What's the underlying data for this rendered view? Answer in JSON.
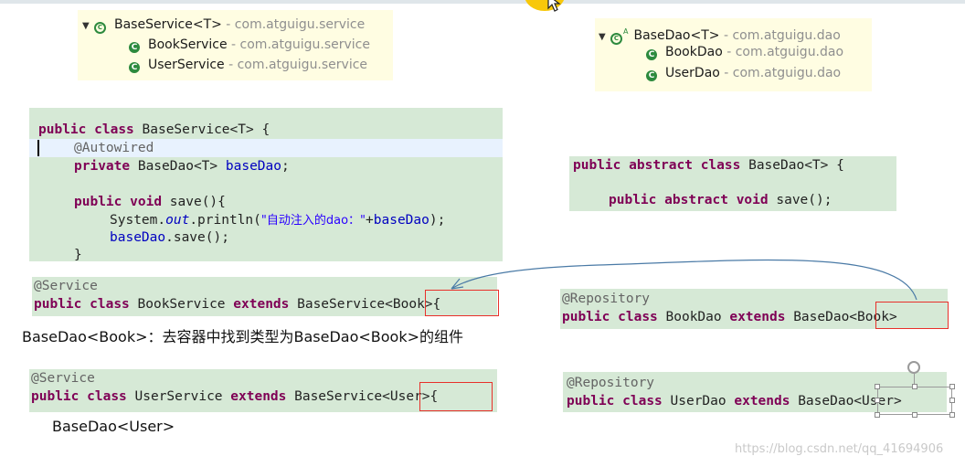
{
  "tree_service": {
    "root": {
      "name": "BaseService<T>",
      "pkg": " - com.atguigu.service"
    },
    "children": [
      {
        "name": "BookService",
        "pkg": " - com.atguigu.service"
      },
      {
        "name": "UserService",
        "pkg": " - com.atguigu.service"
      }
    ]
  },
  "tree_dao": {
    "root": {
      "name": "BaseDao<T>",
      "pkg": " - com.atguigu.dao"
    },
    "children": [
      {
        "name": "BookDao",
        "pkg": " - com.atguigu.dao"
      },
      {
        "name": "UserDao",
        "pkg": " - com.atguigu.dao"
      }
    ]
  },
  "base_service_code": {
    "l1": {
      "kw1": "public",
      "kw2": "class",
      "rest": " BaseService<T> {"
    },
    "l2": {
      "ann": "@Autowired"
    },
    "l3": {
      "kw": "private",
      "type": " BaseDao<T> ",
      "field": "baseDao",
      "end": ";"
    },
    "l4": {
      "kw1": "public",
      "kw2": "void",
      "rest": " save(){"
    },
    "l5": {
      "pre": "System.",
      "out": "out",
      "mid": ".println(",
      "str": "\"自动注入的dao：\"",
      "plus": "+",
      "field": "baseDao",
      "end": ");"
    },
    "l6": {
      "field": "baseDao",
      "rest": ".save();"
    },
    "l7": {
      "text": "}"
    }
  },
  "base_dao_code": {
    "l1": {
      "kw1": "public",
      "kw2": "abstract",
      "kw3": "class",
      "rest": " BaseDao<T> {"
    },
    "l2": {
      "kw1": "public",
      "kw2": "abstract",
      "kw3": "void",
      "rest": " save();"
    }
  },
  "book_service_code": {
    "ann": "@Service",
    "kw1": "public",
    "kw2": "class",
    "name": " BookService ",
    "kw3": "extends",
    "rest": " BaseService<Book>{"
  },
  "user_service_code": {
    "ann": "@Service",
    "kw1": "public",
    "kw2": "class",
    "name": " UserService ",
    "kw3": "extends",
    "rest": " BaseService<User>{"
  },
  "book_dao_code": {
    "ann": "@Repository",
    "kw1": "public",
    "kw2": "class",
    "name": " BookDao ",
    "kw3": "extends",
    "rest": " BaseDao<Book>"
  },
  "user_dao_code": {
    "ann": "@Repository",
    "kw1": "public",
    "kw2": "class",
    "name": " UserDao ",
    "kw3": "extends",
    "rest": " BaseDao<User>"
  },
  "notes": {
    "book": "BaseDao<Book>：去容器中找到类型为BaseDao<Book>的组件",
    "user": "BaseDao<User>"
  },
  "watermark": "https://blog.csdn.net/qq_41694906",
  "colors": {
    "keyword": "#7f0055",
    "annotation": "#646464",
    "field": "#0000c0",
    "string": "#2a00ff",
    "highlight_box": "#e8302a",
    "code_bg": "#d6e9d6",
    "tree_bg": "#fffde2"
  }
}
